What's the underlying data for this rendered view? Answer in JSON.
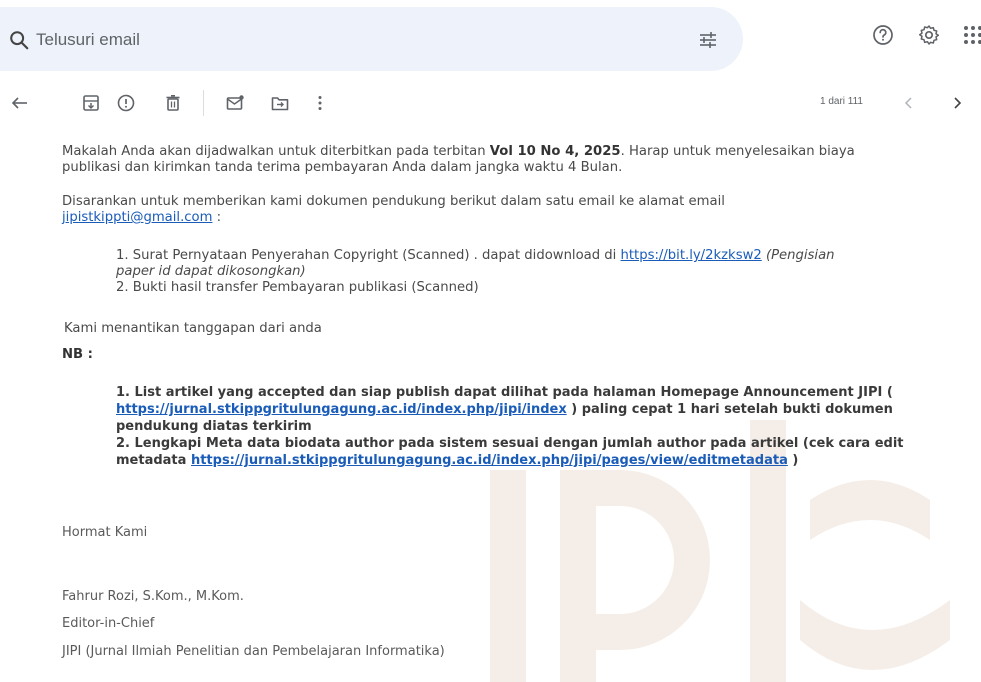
{
  "search": {
    "placeholder": "Telusuri email"
  },
  "toolbar": {
    "pager_text": "1 dari 111"
  },
  "icons": {
    "search": "search-icon",
    "filter": "filter-icon",
    "help": "help-icon",
    "settings": "gear-icon",
    "apps": "apps-grid-icon",
    "back": "back-arrow-icon",
    "archive": "archive-icon",
    "report": "report-spam-icon",
    "delete": "trash-icon",
    "unread": "mark-unread-icon",
    "move": "move-to-icon",
    "more": "more-vert-icon",
    "prev": "chevron-left-icon",
    "next": "chevron-right-icon"
  },
  "email": {
    "p1_a": "Makalah Anda akan dijadwalkan untuk diterbitkan pada terbitan ",
    "p1_bold": "Vol 10 No 4, 2025",
    "p1_b": ". Harap untuk menyelesaikan biaya",
    "p1_line2": "publikasi dan kirimkan tanda terima pembayaran Anda dalam jangka waktu 4 Bulan.",
    "p2_line1": "Disarankan untuk memberikan kami dokumen pendukung berikut dalam satu email ke alamat email",
    "p2_email": "jipistkippti@gmail.com",
    "p2_colon": " :",
    "item1_a": "1.  Surat Pernyataan Penyerahan Copyright (Scanned) . dapat didownload di ",
    "item1_link": "https://bit.ly/2kzksw2",
    "item1_b": " (Pengisian",
    "item1_line2": "paper id dapat dikosongkan)",
    "item2": "2.  Bukti hasil transfer Pembayaran publikasi (Scanned)",
    "p3": "Kami menantikan tanggapan dari anda",
    "nb": "NB :",
    "nb1_a": "1.  List artikel yang accepted dan siap publish dapat dilihat pada halaman Homepage Announcement JIPI (",
    "nb1_link": "https://jurnal.stkippgritulungagung.ac.id/index.php/jipi/index",
    "nb1_b": " ) paling cepat 1 hari setelah bukti dokumen",
    "nb1_line3": "pendukung diatas terkirim",
    "nb2_a": "2.  Lengkapi Meta data biodata author pada sistem sesuai dengan jumlah author pada artikel (cek cara edit",
    "nb2_b": "metadata ",
    "nb2_link": "https://jurnal.stkippgritulungagung.ac.id/index.php/jipi/pages/view/editmetadata",
    "nb2_c": " )",
    "closing": "Hormat Kami",
    "sig_name": "Fahrur Rozi, S.Kom., M.Kom.",
    "sig_role": "Editor-in-Chief",
    "sig_org": "JIPI (Jurnal Ilmiah Penelitian dan Pembelajaran Informatika)"
  }
}
